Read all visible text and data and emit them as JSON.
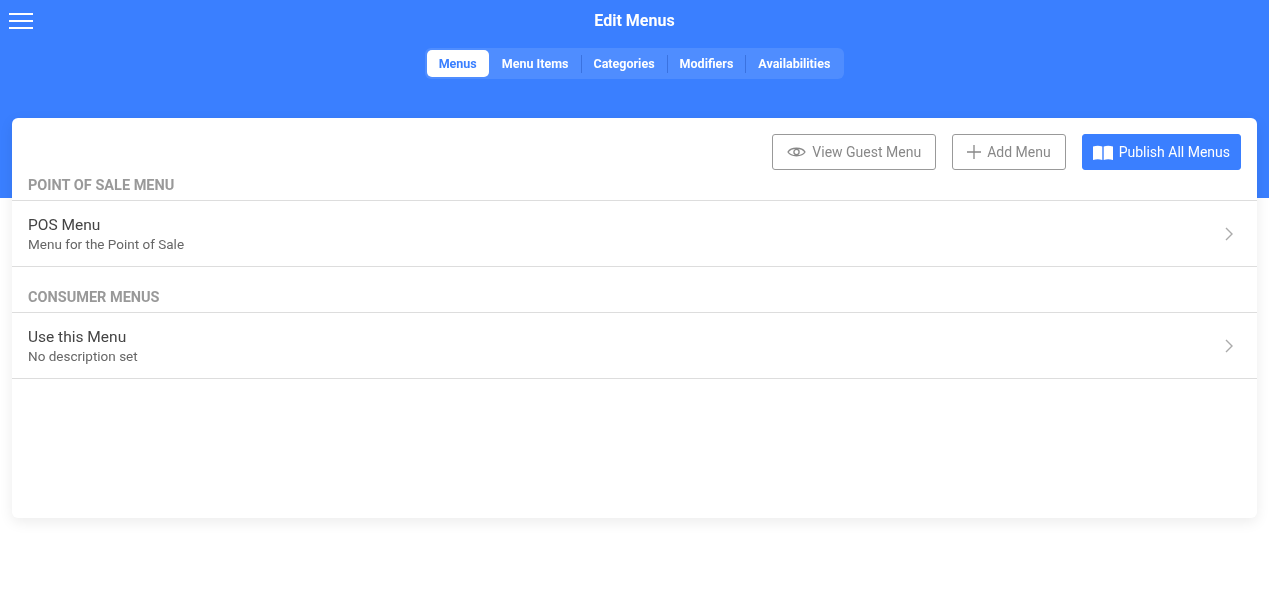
{
  "header": {
    "title": "Edit Menus"
  },
  "tabs": [
    {
      "label": "Menus",
      "selected": true
    },
    {
      "label": "Menu Items",
      "selected": false
    },
    {
      "label": "Categories",
      "selected": false
    },
    {
      "label": "Modifiers",
      "selected": false
    },
    {
      "label": "Availabilities",
      "selected": false
    }
  ],
  "actions": [
    {
      "label": "View Guest Menu",
      "kind": "outline"
    },
    {
      "label": "Add Menu",
      "kind": "outline"
    },
    {
      "label": "Publish All Menus",
      "kind": "primary"
    }
  ],
  "sections": [
    {
      "title": "POINT OF SALE MENU",
      "items": [
        {
          "name": "POS Menu",
          "description": "Menu for the Point of Sale"
        }
      ]
    },
    {
      "title": "CONSUMER MENUS",
      "items": [
        {
          "name": "Use this Menu",
          "description": "No description set"
        }
      ]
    }
  ]
}
